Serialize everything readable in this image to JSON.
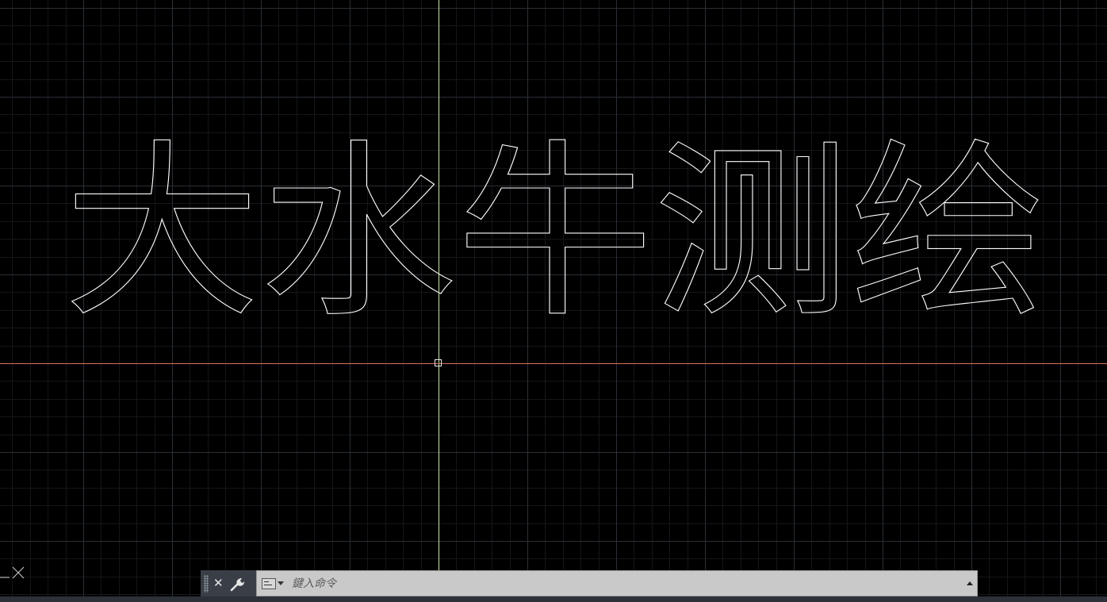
{
  "drawing": {
    "outline_text": "大水牛测绘"
  },
  "command_line": {
    "placeholder": "鍵入命令",
    "value": ""
  },
  "icons": {
    "close": "close-icon",
    "customize": "wrench-icon",
    "prompt": "command-prompt-icon",
    "history": "chevron-up-icon",
    "ucs": "ucs-icon"
  },
  "colors": {
    "background": "#000000",
    "grid_major": "#2a2f36",
    "grid_minor": "#121418",
    "crosshair_vertical": "#c9e7a7",
    "crosshair_horizontal": "#d9745a",
    "text_outline": "#ffffff",
    "command_bar": "#c9c9c9"
  }
}
